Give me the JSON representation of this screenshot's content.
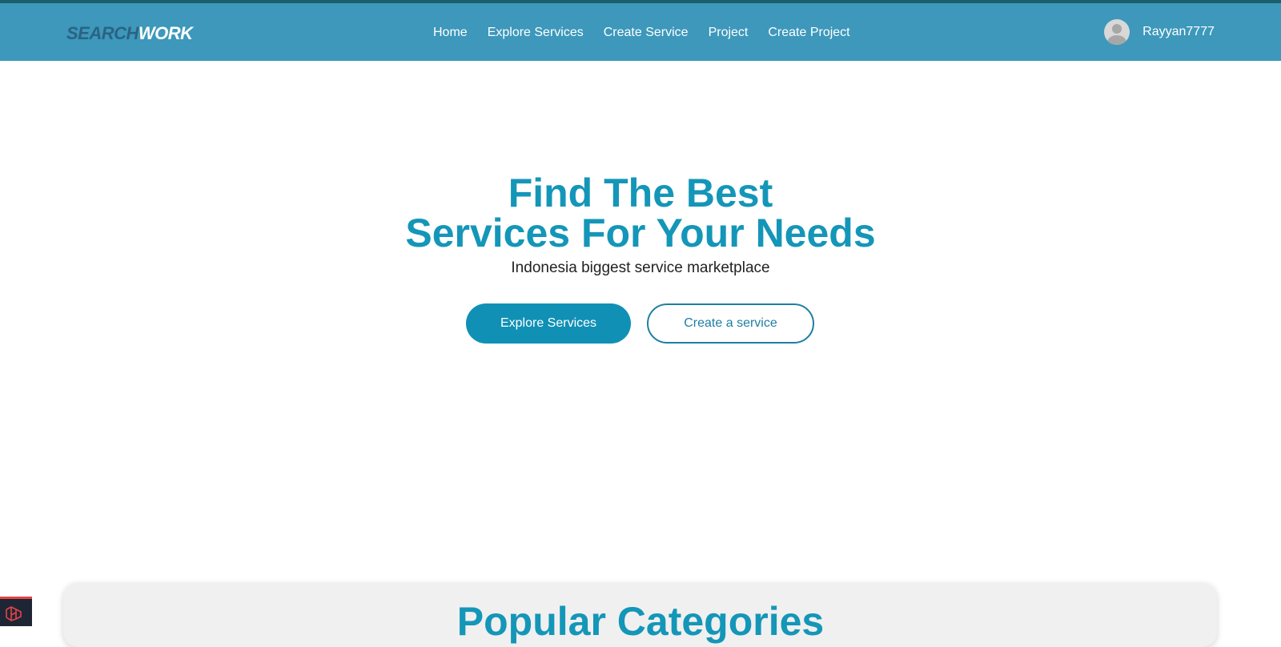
{
  "brand": {
    "part1": "SEARCH",
    "part2": "WORK"
  },
  "nav": {
    "links": [
      "Home",
      "Explore Services",
      "Create Service",
      "Project",
      "Create Project"
    ]
  },
  "user": {
    "name": "Rayyan7777",
    "avatar_icon": "user-avatar-icon"
  },
  "hero": {
    "title_line1": "Find The Best",
    "title_line2": "Services For Your Needs",
    "subtitle": "Indonesia biggest service marketplace",
    "primary_button": "Explore Services",
    "secondary_button": "Create a service"
  },
  "categories": {
    "title": "Popular Categories"
  },
  "debug_bar": {
    "icon": "laravel-icon"
  },
  "colors": {
    "navbar": "#3d98bb",
    "accent": "#1496b8",
    "button_primary": "#1190b5",
    "button_outline": "#1e7fa2"
  }
}
